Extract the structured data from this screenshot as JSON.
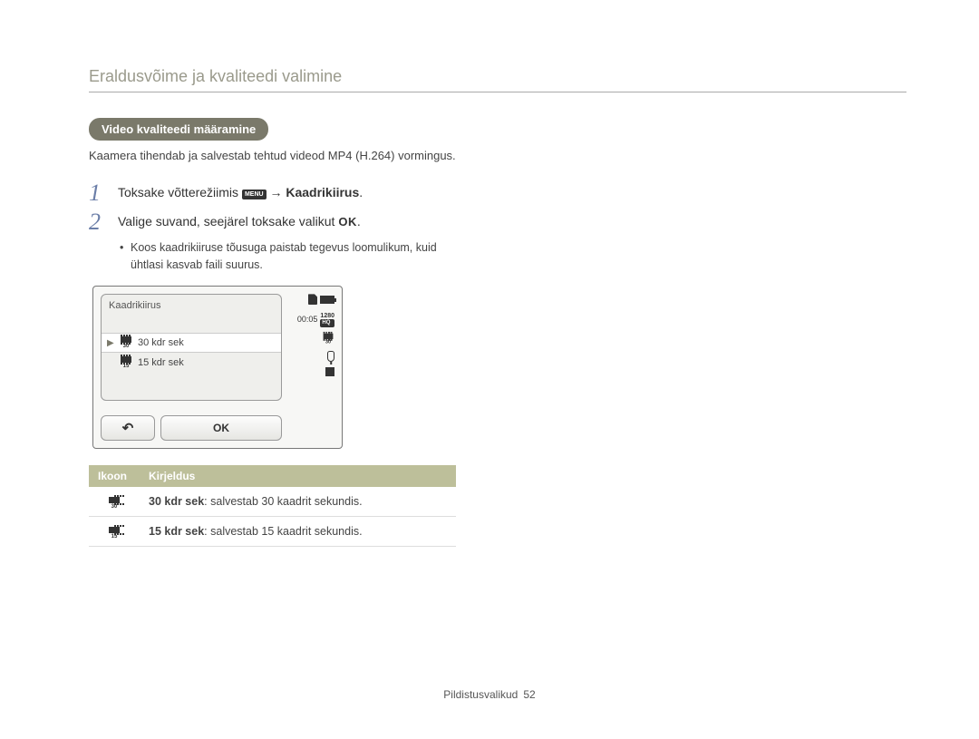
{
  "page_title": "Eraldusvõime ja kvaliteedi valimine",
  "pill": "Video kvaliteedi määramine",
  "intro": "Kaamera tihendab ja salvestab tehtud videod MP4 (H.264) vormingus.",
  "step1_prefix": "Toksake võtterežiimis ",
  "step1_menu": "MENU",
  "step1_arrow": " → ",
  "step1_bold": "Kaadrikiirus",
  "step1_suffix": ".",
  "step2_prefix": "Valige suvand, seejärel toksake valikut ",
  "step2_ok": "OK",
  "step2_suffix": ".",
  "sub_bullet": "Koos kaadrikiiruse tõusuga paistab tegevus loomulikum, kuid ühtlasi kasvab faili suurus.",
  "cam": {
    "title": "Kaadrikiirus",
    "opt30": "30 kdr sek",
    "opt30_sub": "30",
    "opt15": "15 kdr sek",
    "opt15_sub": "15",
    "back": "↶",
    "ok": "OK",
    "time": "00:05",
    "res_top": "1280",
    "res_bot": "HQ",
    "film_sub": "30"
  },
  "table": {
    "h1": "Ikoon",
    "h2": "Kirjeldus",
    "rows": [
      {
        "sub": "30",
        "bold": "30 kdr sek",
        "rest": ": salvestab 30 kaadrit sekundis."
      },
      {
        "sub": "15",
        "bold": "15 kdr sek",
        "rest": ": salvestab 15 kaadrit sekundis."
      }
    ]
  },
  "footer_section": "Pildistusvalikud",
  "footer_page": "52"
}
